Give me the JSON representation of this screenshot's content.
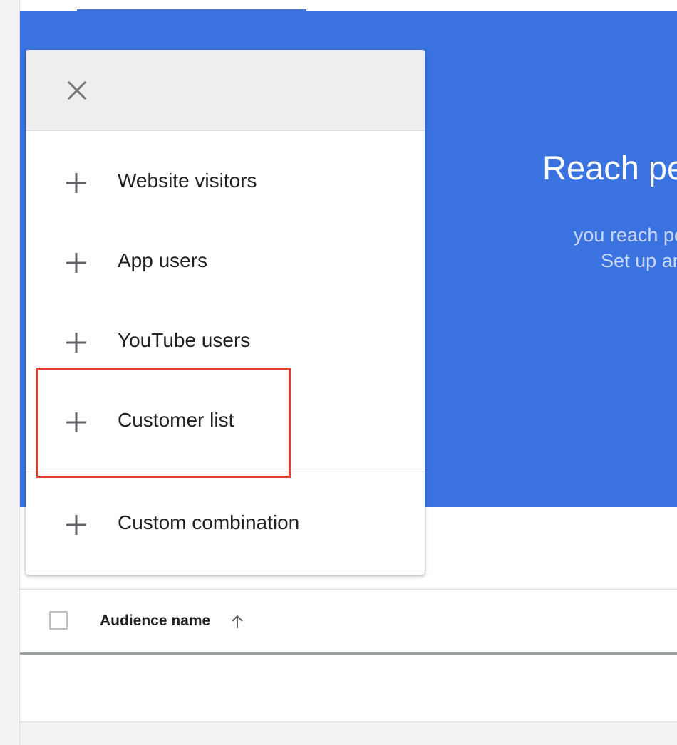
{
  "banner": {
    "title": "Reach pe",
    "subtitle_line1": "you reach people who have",
    "subtitle_line2": "Set up an audience s"
  },
  "menu": {
    "close_icon": "close-icon",
    "items": [
      {
        "label": "Website visitors",
        "icon": "plus-icon"
      },
      {
        "label": "App users",
        "icon": "plus-icon"
      },
      {
        "label": "YouTube users",
        "icon": "plus-icon"
      },
      {
        "label": "Customer list",
        "icon": "plus-icon"
      },
      {
        "label": "Custom combination",
        "icon": "plus-icon"
      }
    ]
  },
  "table": {
    "column_header": "Audience name",
    "sort_icon": "arrow-up-icon"
  },
  "colors": {
    "banner_blue": "#3a73df",
    "highlight_red": "#e0402e"
  }
}
